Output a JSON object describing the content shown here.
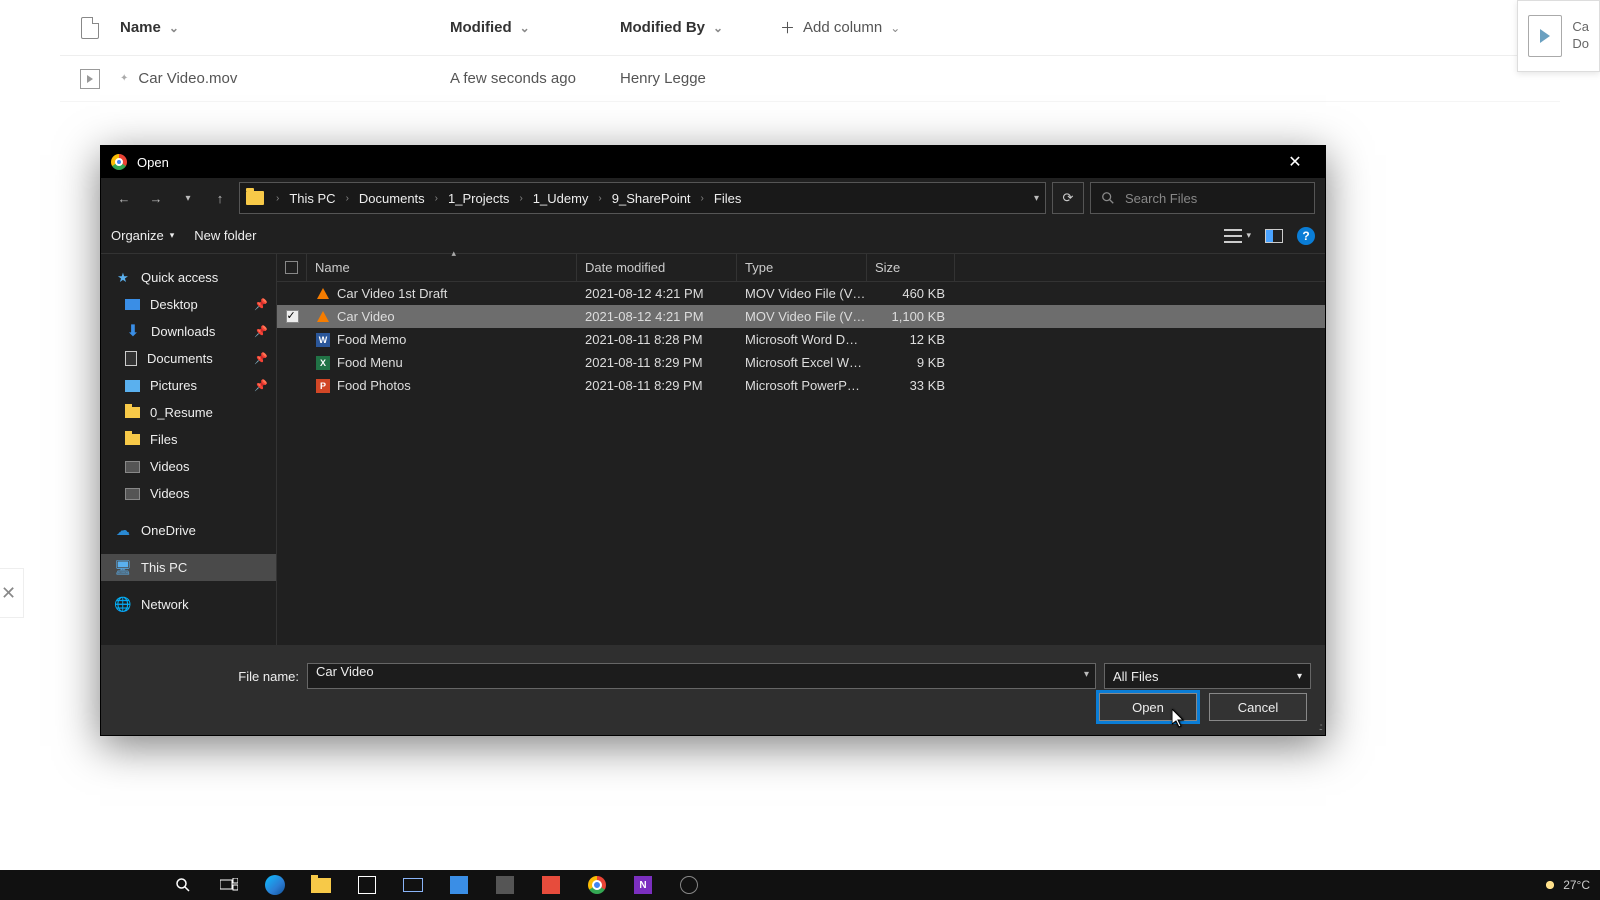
{
  "sharepoint": {
    "columns": {
      "name": "Name",
      "modified": "Modified",
      "modifiedBy": "Modified By",
      "add": "Add column"
    },
    "row": {
      "name": "Car Video.mov",
      "modified": "A few seconds ago",
      "by": "Henry Legge"
    },
    "preview": {
      "title": "Ca",
      "sub": "Do"
    },
    "edgeX": "✕"
  },
  "dialog": {
    "title": "Open",
    "closeGlyph": "✕",
    "nav": {
      "backGlyph": "←",
      "fwdGlyph": "→",
      "recentGlyph": "▾",
      "upGlyph": "↑",
      "refreshGlyph": "⟳",
      "addrDropGlyph": "▾"
    },
    "breadcrumb": [
      "This PC",
      "Documents",
      "1_Projects",
      "1_Udemy",
      "9_SharePoint",
      "Files"
    ],
    "search": {
      "placeholder": "Search Files"
    },
    "toolbar": {
      "organize": "Organize",
      "organizeChev": "▾",
      "newFolder": "New folder",
      "viewChev": "▾",
      "help": "?"
    },
    "sidebar": {
      "quickAccess": "Quick access",
      "pinned": [
        {
          "label": "Desktop",
          "icon": "blue"
        },
        {
          "label": "Downloads",
          "icon": "down"
        },
        {
          "label": "Documents",
          "icon": "doc"
        },
        {
          "label": "Pictures",
          "icon": "pic"
        },
        {
          "label": "0_Resume",
          "icon": "folder"
        },
        {
          "label": "Files",
          "icon": "folder"
        },
        {
          "label": "Videos",
          "icon": "vid"
        },
        {
          "label": "Videos",
          "icon": "vid"
        }
      ],
      "onedrive": "OneDrive",
      "thispc": "This PC",
      "network": "Network"
    },
    "list": {
      "head": {
        "name": "Name",
        "date": "Date modified",
        "type": "Type",
        "size": "Size",
        "sortGlyph": "▴"
      },
      "rows": [
        {
          "sel": false,
          "icon": "vlc",
          "name": "Car Video 1st Draft",
          "date": "2021-08-12 4:21 PM",
          "type": "MOV Video File (V…",
          "size": "460 KB"
        },
        {
          "sel": true,
          "icon": "vlc",
          "name": "Car Video",
          "date": "2021-08-12 4:21 PM",
          "type": "MOV Video File (V…",
          "size": "1,100 KB"
        },
        {
          "sel": false,
          "icon": "word",
          "name": "Food Memo",
          "date": "2021-08-11 8:28 PM",
          "type": "Microsoft Word D…",
          "size": "12 KB"
        },
        {
          "sel": false,
          "icon": "excel",
          "name": "Food Menu",
          "date": "2021-08-11 8:29 PM",
          "type": "Microsoft Excel W…",
          "size": "9 KB"
        },
        {
          "sel": false,
          "icon": "ppt",
          "name": "Food Photos",
          "date": "2021-08-11 8:29 PM",
          "type": "Microsoft PowerP…",
          "size": "33 KB"
        }
      ]
    },
    "footer": {
      "fileNameLabel": "File name:",
      "fileNameValue": "Car Video",
      "typeFilter": "All Files",
      "typeChev": "▾",
      "open": "Open",
      "cancel": "Cancel",
      "grip": ".::"
    }
  },
  "taskbar": {
    "temp": "27°C"
  }
}
